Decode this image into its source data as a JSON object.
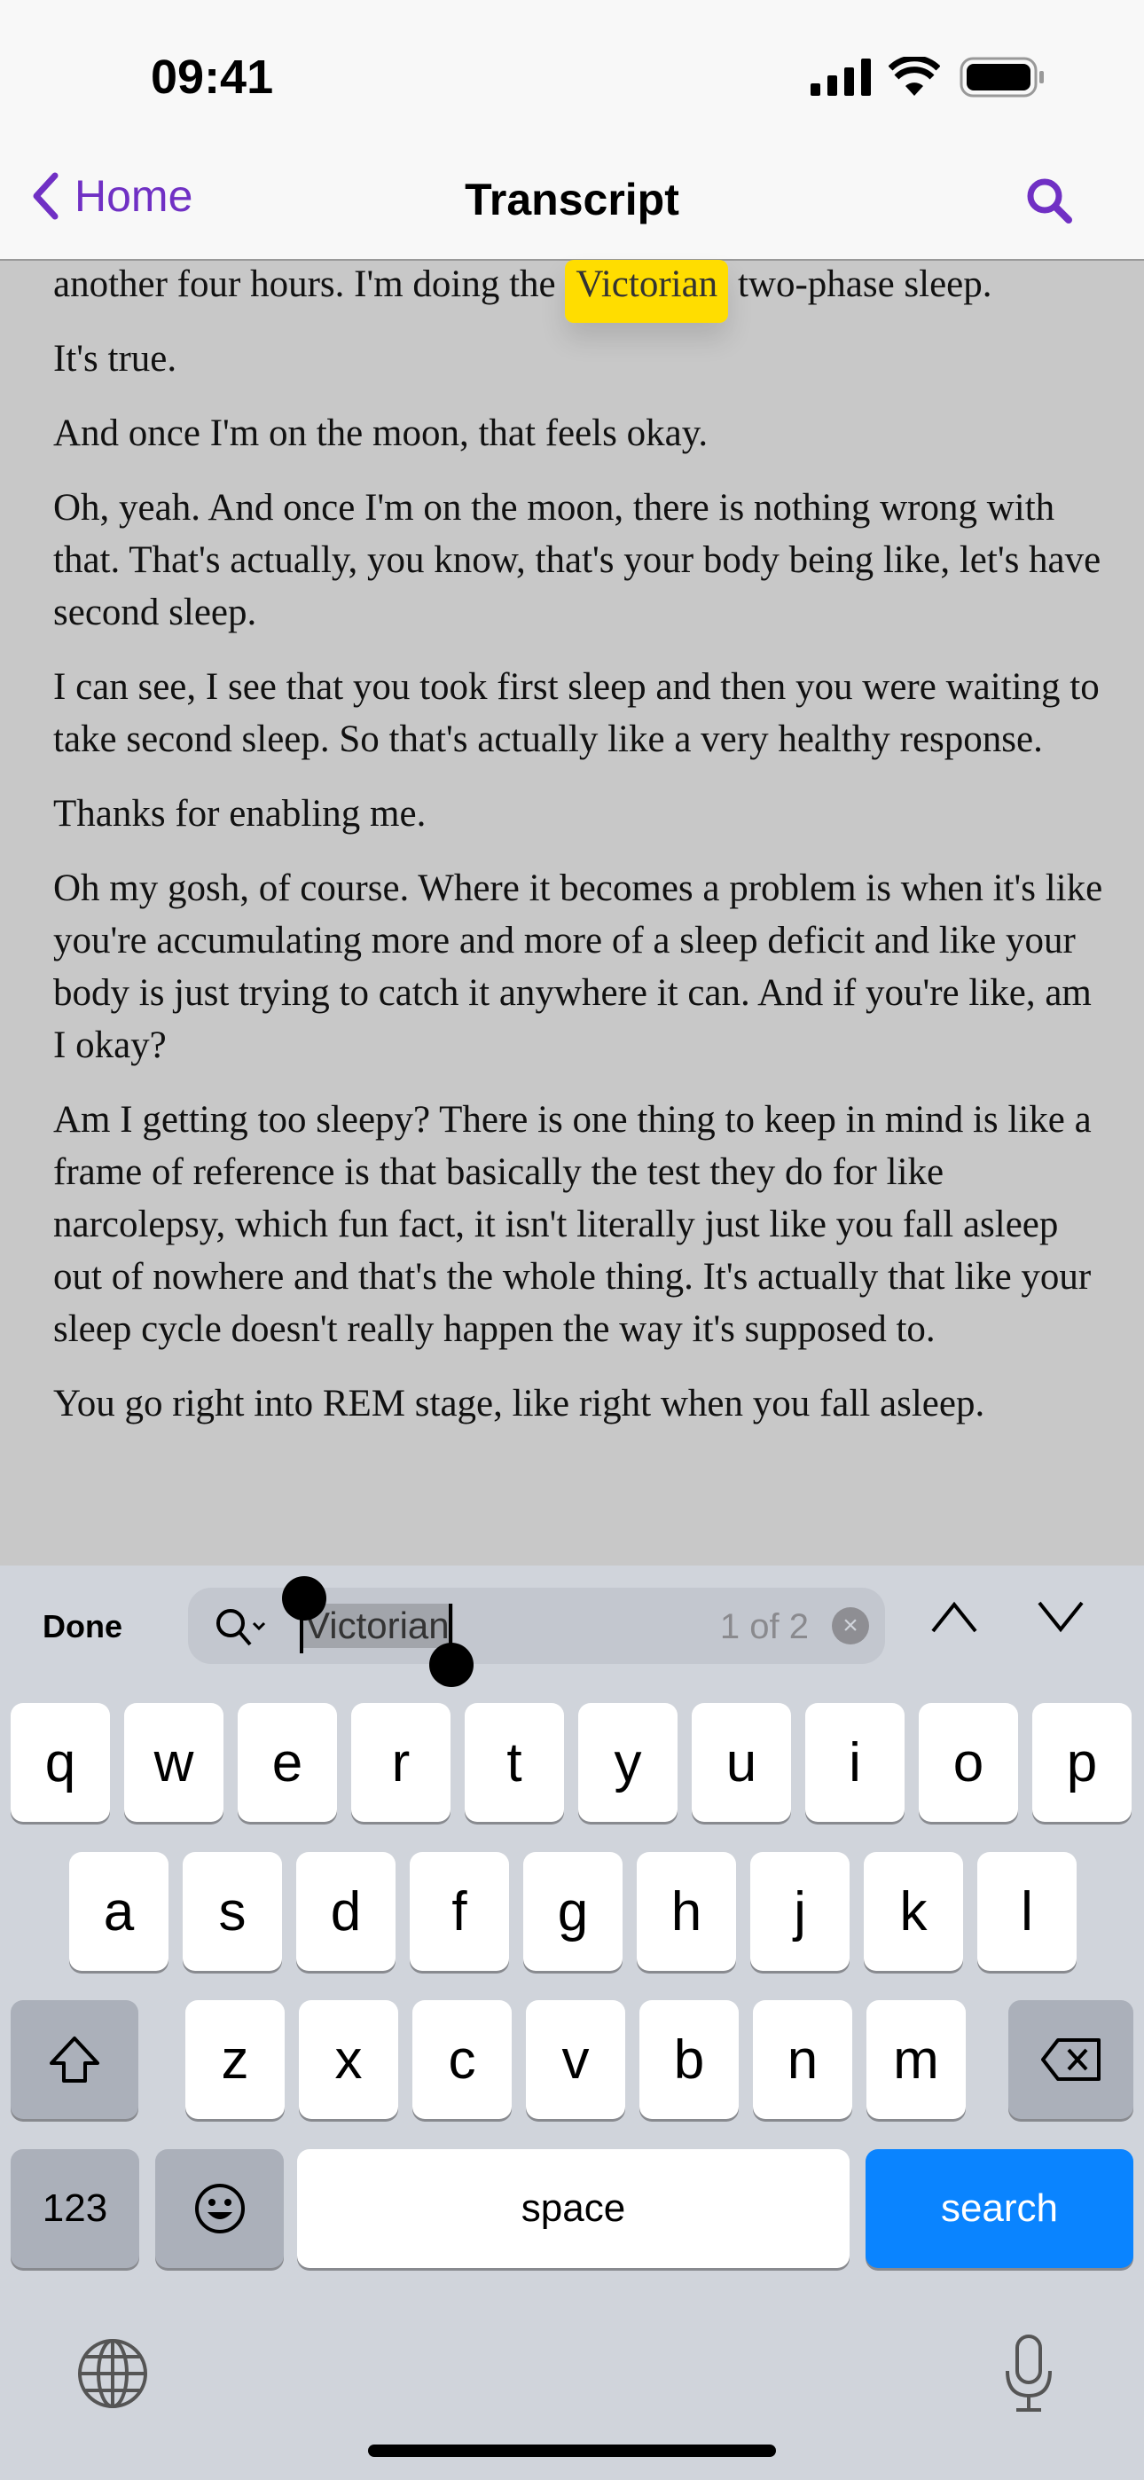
{
  "status_bar": {
    "time": "09:41"
  },
  "nav": {
    "back_label": "Home",
    "title": "Transcript",
    "accent": "#7030c4"
  },
  "transcript": {
    "first": {
      "before": "another four hours. I'm doing the ",
      "match": "Victorian",
      "after": " two-phase sleep."
    },
    "paragraphs": [
      "It's true.",
      "And once I'm on the moon, that feels okay.",
      "Oh, yeah. And once I'm on the moon, there is nothing wrong with that. That's actually, you know, that's your body being like, let's have second sleep.",
      "I can see, I see that you took first sleep and then you were waiting to take second sleep. So that's actually like a very healthy response.",
      "Thanks for enabling me.",
      "Oh my gosh, of course. Where it becomes a problem is when it's like you're accumulating more and more of a sleep deficit and like your body is just trying to catch it anywhere it can. And if you're like, am I okay?",
      "Am I getting too sleepy? There is one thing to keep in mind is like a frame of reference is that basically the test they do for like narcolepsy, which fun fact, it isn't literally just like you fall asleep out of nowhere and that's the whole thing. It's actually that like your sleep cycle doesn't really happen the way it's supposed to.",
      "You go right into REM stage, like right when you fall asleep."
    ],
    "highlight_color": "#ffdd00"
  },
  "find_bar": {
    "done_label": "Done",
    "query": "Victorian",
    "match_count": "1 of 2"
  },
  "keyboard": {
    "row1": [
      "q",
      "w",
      "e",
      "r",
      "t",
      "y",
      "u",
      "i",
      "o",
      "p"
    ],
    "row2": [
      "a",
      "s",
      "d",
      "f",
      "g",
      "h",
      "j",
      "k",
      "l"
    ],
    "row3": [
      "z",
      "x",
      "c",
      "v",
      "b",
      "n",
      "m"
    ],
    "numbers_label": "123",
    "space_label": "space",
    "search_label": "search",
    "search_color": "#0a84ff"
  }
}
